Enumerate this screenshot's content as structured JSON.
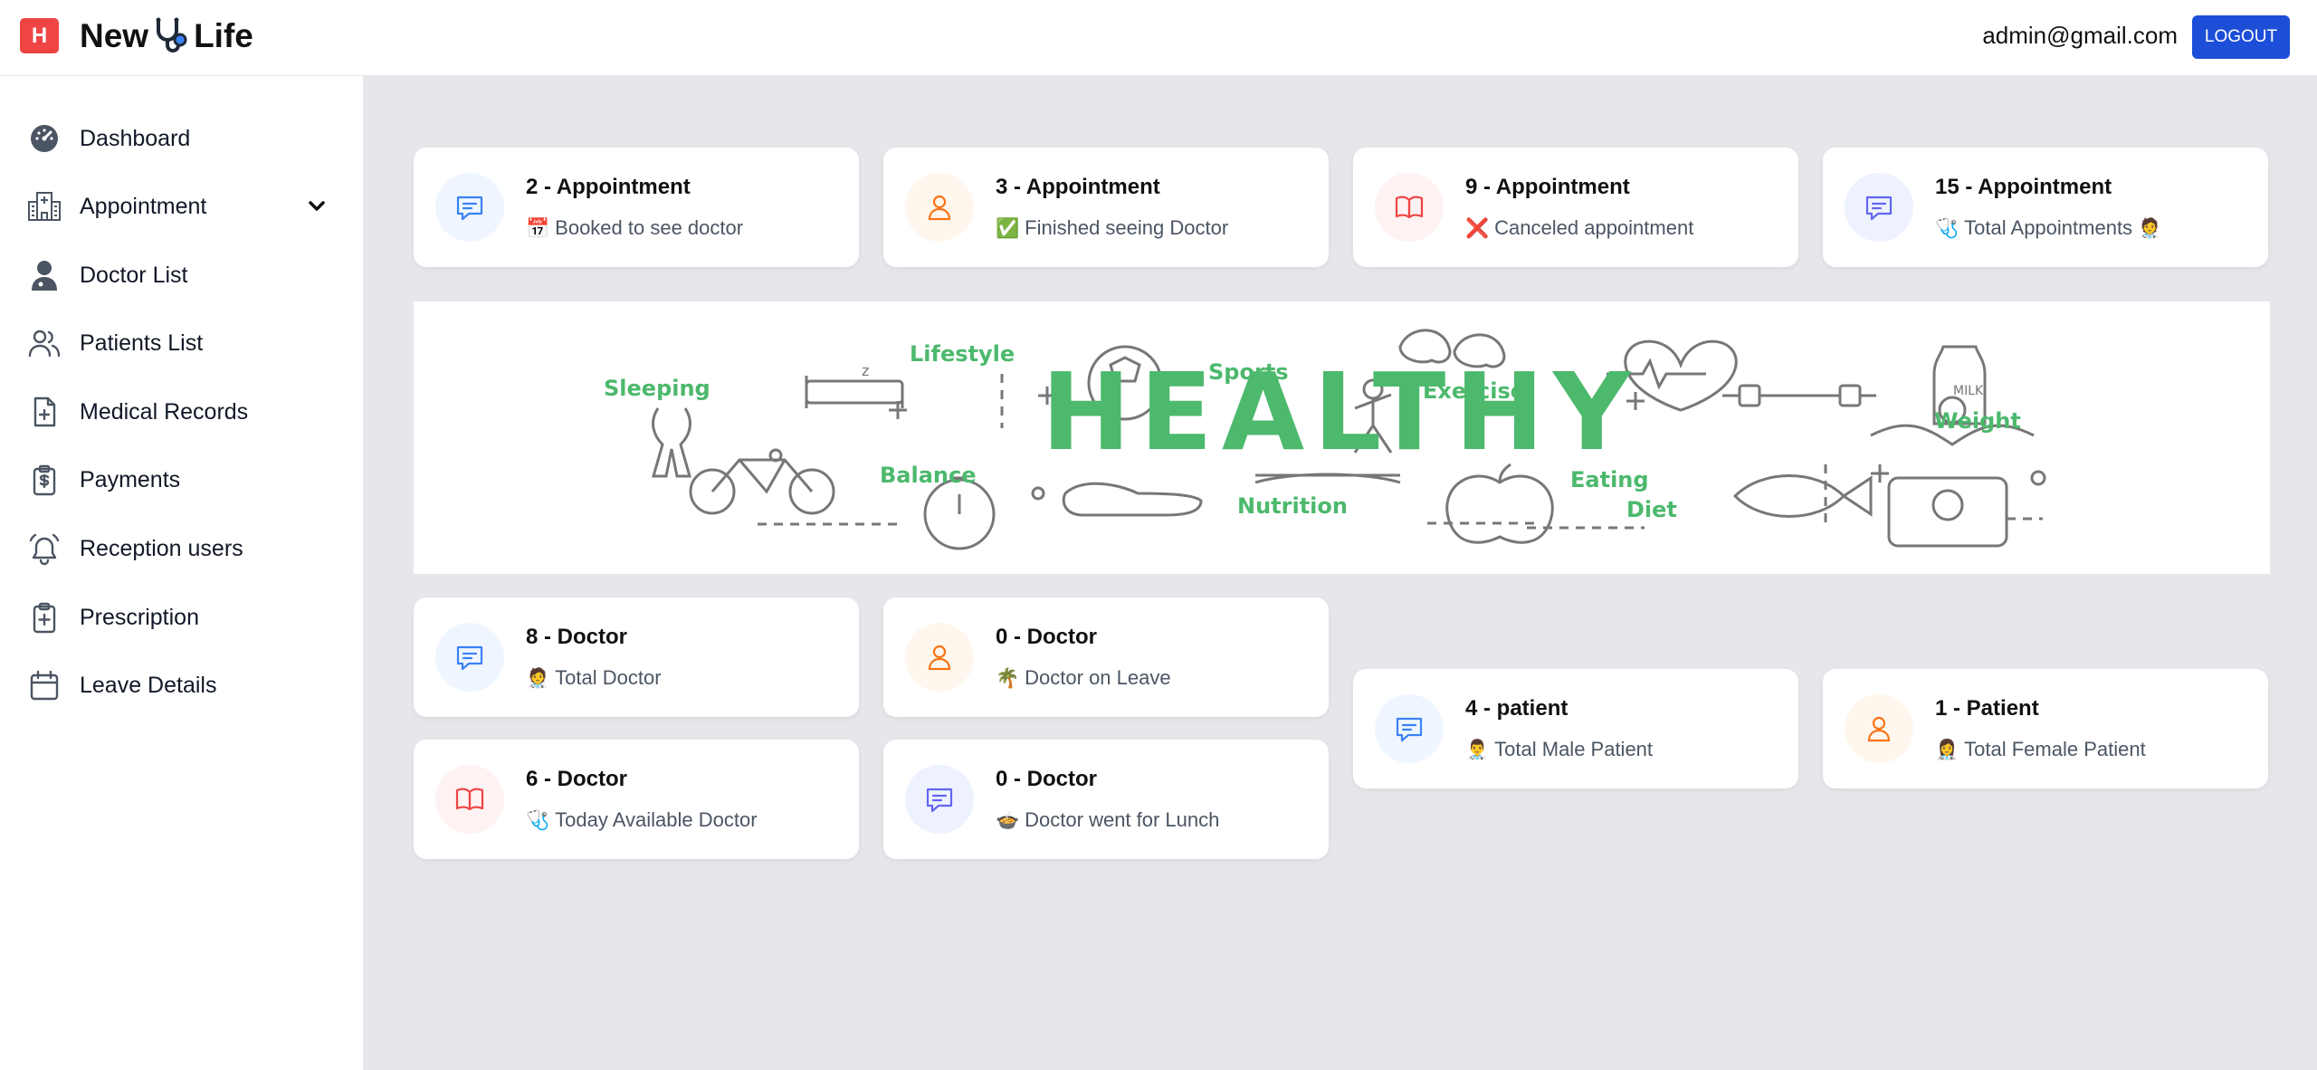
{
  "header": {
    "logo_letter": "H",
    "brand_left": "New",
    "brand_right": "Life",
    "user_email": "admin@gmail.com",
    "logout_label": "LOGOUT"
  },
  "sidebar": {
    "items": [
      {
        "label": "Dashboard",
        "icon": "dashboard-gauge-icon"
      },
      {
        "label": "Appointment",
        "icon": "hospital-icon",
        "expandable": true
      },
      {
        "label": "Doctor List",
        "icon": "doctor-icon"
      },
      {
        "label": "Patients List",
        "icon": "users-icon"
      },
      {
        "label": "Medical Records",
        "icon": "file-plus-icon"
      },
      {
        "label": "Payments",
        "icon": "clipboard-dollar-icon"
      },
      {
        "label": "Reception users",
        "icon": "bell-icon"
      },
      {
        "label": "Prescription",
        "icon": "clipboard-plus-icon"
      },
      {
        "label": "Leave Details",
        "icon": "calendar-icon"
      }
    ]
  },
  "stats": {
    "appointments": [
      {
        "title": "2 - Appointment",
        "subtitle": "Booked to see doctor",
        "emoji": "📅",
        "icon": "chat-icon",
        "color": "#3b82f6"
      },
      {
        "title": "3 - Appointment",
        "subtitle": "Finished seeing Doctor",
        "emoji": "✅",
        "icon": "user-icon",
        "color": "#f97316"
      },
      {
        "title": "9 - Appointment",
        "subtitle": "Canceled appointment",
        "emoji": "❌",
        "icon": "book-icon",
        "color": "#ef4444"
      },
      {
        "title": "15 - Appointment",
        "subtitle": "Total Appointments",
        "emoji": "🩺",
        "emoji_after": "🧑‍⚕️",
        "icon": "chat-icon",
        "color": "#6366f1"
      }
    ],
    "doctors": [
      {
        "title": "8 - Doctor",
        "subtitle": "Total Doctor",
        "emoji": "🧑‍⚕️",
        "icon": "chat-icon",
        "color": "#3b82f6"
      },
      {
        "title": "0 - Doctor",
        "subtitle": "Doctor on Leave",
        "emoji": "🌴",
        "icon": "user-icon",
        "color": "#f97316"
      },
      {
        "title": "6 - Doctor",
        "subtitle": "Today Available Doctor",
        "emoji": "🩺",
        "icon": "book-icon",
        "color": "#ef4444"
      },
      {
        "title": "0 - Doctor",
        "subtitle": "Doctor went for Lunch",
        "emoji": "🍲",
        "icon": "chat-icon",
        "color": "#6366f1"
      }
    ],
    "patients": [
      {
        "title": "4 - patient",
        "subtitle": "Total Male Patient",
        "emoji": "👨‍⚕️",
        "icon": "chat-icon",
        "color": "#3b82f6"
      },
      {
        "title": "1 - Patient",
        "subtitle": "Total Female Patient",
        "emoji": "👩‍⚕️",
        "icon": "user-icon",
        "color": "#f97316"
      }
    ]
  },
  "banner": {
    "main_word": "HEALTHY",
    "words": [
      "Lifestyle",
      "Sleeping",
      "Sports",
      "Exercise",
      "Weight",
      "Balance",
      "Nutrition",
      "Eating",
      "Diet"
    ],
    "milk_label": "MILK",
    "accent_color": "#4cb96d"
  }
}
